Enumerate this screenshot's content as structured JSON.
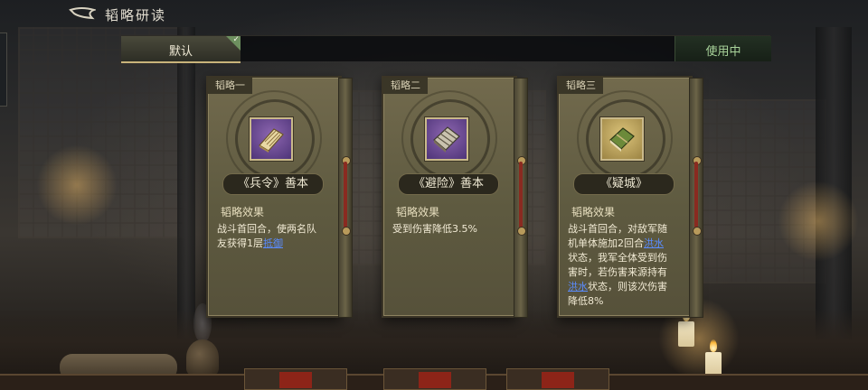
{
  "header": {
    "title": "韬略研读"
  },
  "tabs": {
    "default_label": "默认",
    "status_label": "使用中"
  },
  "cards": [
    {
      "slot": "韬略一",
      "name": "《兵令》善本",
      "section": "韬略效果",
      "desc_before": "战斗首回合，使两名队友获得1层",
      "keyword": "抵御",
      "desc_after": "",
      "icon_color": "purple"
    },
    {
      "slot": "韬略二",
      "name": "《避险》善本",
      "section": "韬略效果",
      "desc_before": "受到伤害降低3.5%",
      "keyword": "",
      "desc_after": "",
      "icon_color": "purple"
    },
    {
      "slot": "韬略三",
      "name": "《疑城》",
      "section": "韬略效果",
      "desc_1": "战斗首回合，对敌军随机单体施加2回合",
      "keyword_1": "洪水",
      "desc_2": "状态，我军全体受到伤害时，若伤害来源持有",
      "keyword_2": "洪水",
      "desc_3": "状态，则该次伤害降低8%",
      "icon_color": "gold"
    }
  ],
  "colors": {
    "keyword": "#5a8cff",
    "card_bg": "#6a6347",
    "in_use": "#a9d49b"
  }
}
